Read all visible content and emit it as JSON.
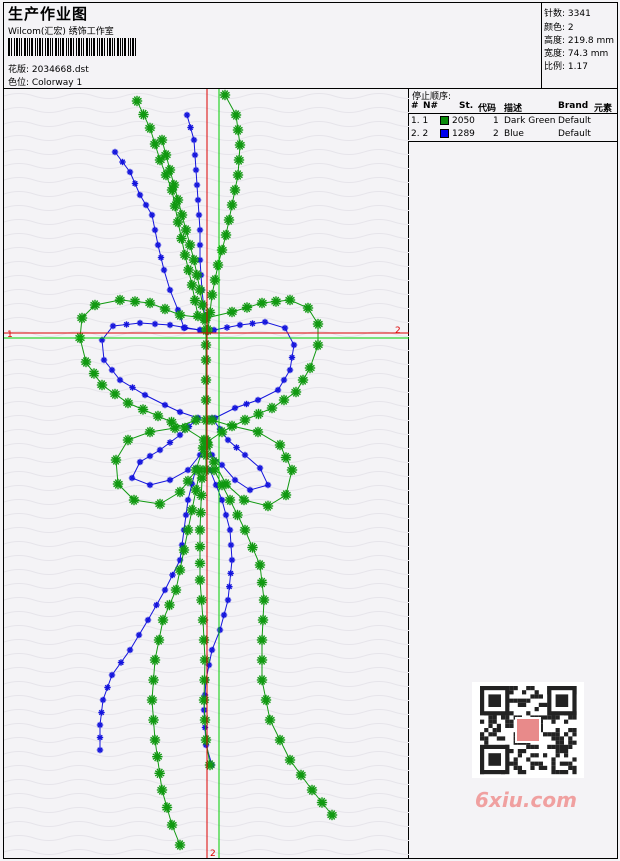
{
  "header": {
    "title": "生产作业图",
    "subtitle": "Wilcom(汇宏) 绣饰工作室",
    "design_label": "花版: 2034668.dst",
    "colorway_label": "色位: Colorway 1"
  },
  "stats": {
    "stitches": "针数: 3341",
    "colors": "颜色: 2",
    "height": "高度: 219.8 mm",
    "width": "宽度: 74.3 mm",
    "scale": "比例: 1.17"
  },
  "stop_sequence": {
    "title": "停止顺序:",
    "headers": [
      "#",
      "N#",
      "St.",
      "代码",
      "描述",
      "Brand",
      "元素"
    ],
    "rows": [
      {
        "index": "1. 1",
        "color": "#0a8a0a",
        "code": "2050",
        "seq": "1",
        "desc": "Dark Green",
        "brand": "Default"
      },
      {
        "index": "2. 2",
        "color": "#0000ee",
        "code": "1289",
        "seq": "2",
        "desc": "Blue",
        "brand": "Default"
      }
    ]
  },
  "crosshair": {
    "h_label_left": "1",
    "h_label_right": "2",
    "v_label_bottom": "2"
  },
  "colors": {
    "green": "#119911",
    "blue": "#1515dd",
    "crosshair_red": "#dd0000",
    "crosshair_green": "#00cc00"
  },
  "watermark": {
    "site": "6xiu.com",
    "qr_icon": "qr-code-icon"
  }
}
